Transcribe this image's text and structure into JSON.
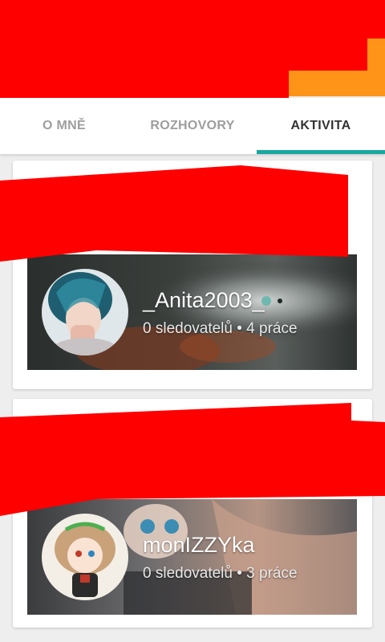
{
  "tabs": [
    {
      "label": "O MNĚ",
      "active": false
    },
    {
      "label": "ROZHOVORY",
      "active": false
    },
    {
      "label": "AKTIVITA",
      "active": true
    }
  ],
  "colors": {
    "header": "#ff9419",
    "tab_indicator": "#1aa89f",
    "redaction": "#ff0000"
  },
  "cards": [
    {
      "username": "_Anita2003_",
      "meta": "0 sledovatelů • 4 práce"
    },
    {
      "username": "monIZZYka",
      "meta": "0 sledovatelů • 3 práce"
    }
  ]
}
